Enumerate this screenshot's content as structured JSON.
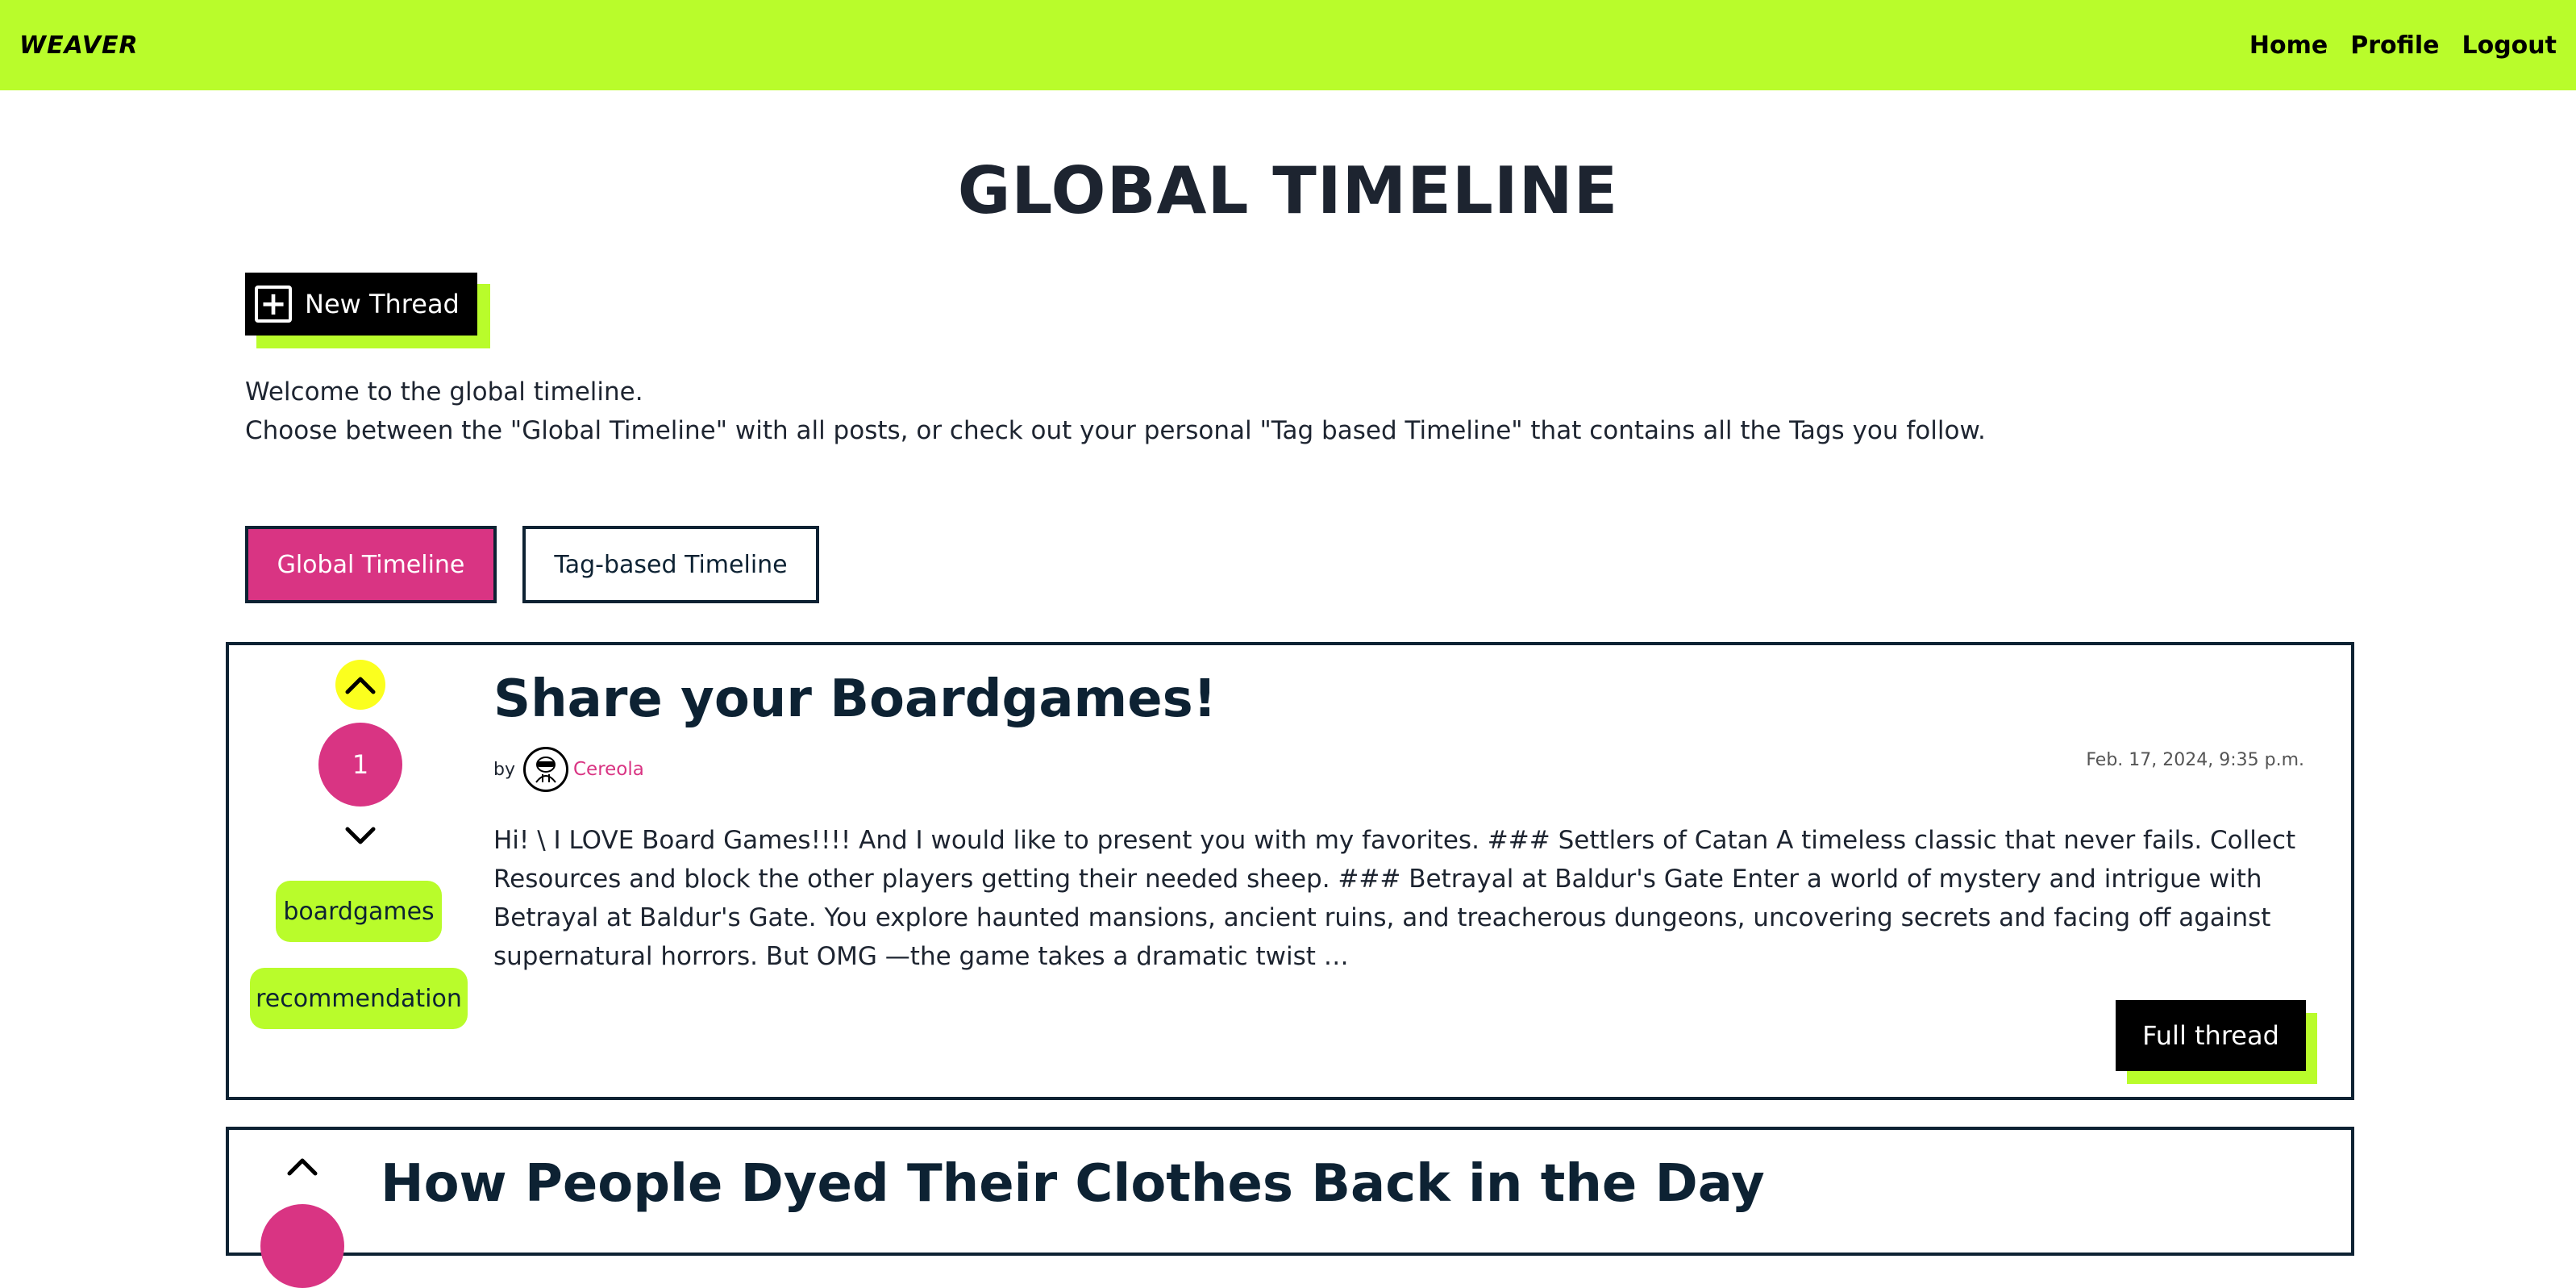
{
  "nav": {
    "brand": "WEAVER",
    "links": [
      "Home",
      "Profile",
      "Logout"
    ]
  },
  "page": {
    "title": "GLOBAL TIMELINE",
    "new_thread_label": "New Thread",
    "intro_line1": "Welcome to the global timeline.",
    "intro_line2": "Choose between the \"Global Timeline\" with all posts, or check out your personal \"Tag based Timeline\" that contains all the Tags you follow."
  },
  "tabs": {
    "global": "Global Timeline",
    "tag_based": "Tag-based Timeline",
    "active": "global"
  },
  "posts": [
    {
      "title": "Share your Boardgames!",
      "by_label": "by",
      "author": "Cereola",
      "date": "Feb. 17, 2024, 9:35 p.m.",
      "votes": "1",
      "upvoted": true,
      "tags": [
        "boardgames",
        "recommendation"
      ],
      "excerpt": "Hi! \\ I LOVE Board Games!!!! And I would like to present you with my favorites. ### Settlers of Catan A timeless classic that never fails. Collect Resources and block the other players getting their needed sheep. ### Betrayal at Baldur's Gate Enter a world of mystery and intrigue with Betrayal at Baldur's Gate. You explore haunted mansions, ancient ruins, and treacherous dungeons, uncovering secrets and facing off against supernatural horrors. But OMG —the game takes a dramatic twist …",
      "button_label": "Full thread"
    },
    {
      "title": "How People Dyed Their Clothes Back in the Day",
      "upvoted": false
    }
  ],
  "colors": {
    "accent_green": "#b9fc2b",
    "accent_pink": "#d93483",
    "upvote_yellow": "#fbff1e",
    "dark": "#0d2233"
  }
}
